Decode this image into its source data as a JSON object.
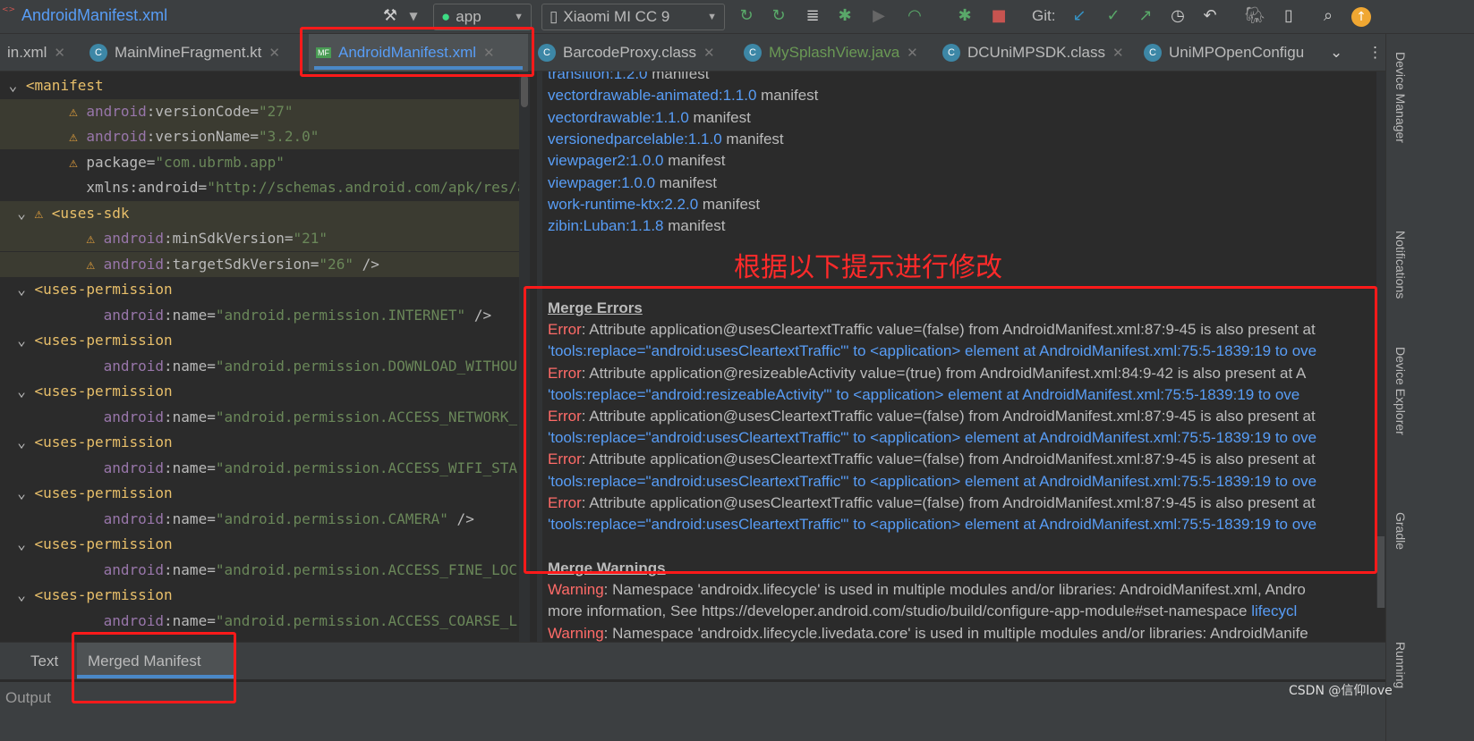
{
  "window": {
    "title": "AndroidManifest.xml",
    "file_icon": "xml-file-icon"
  },
  "toolbar": {
    "run_config": "app",
    "device": "Xiaomi MI CC 9",
    "git_label": "Git:",
    "icons": [
      "hammer-icon",
      "rerun-icon",
      "apply-changes-icon",
      "apply-code-changes-icon",
      "debug-icon",
      "attach-debugger-icon",
      "profile-icon",
      "debug-attach-icon",
      "stop-icon",
      "git-update-icon",
      "git-commit-icon",
      "git-push-icon",
      "history-icon",
      "rollback-icon",
      "gradle-sync-icon",
      "device-manager-icon",
      "search-icon",
      "update-icon"
    ]
  },
  "tabs": [
    {
      "label": "in.xml",
      "active": false
    },
    {
      "label": "MainMineFragment.kt",
      "active": false
    },
    {
      "label": "AndroidManifest.xml",
      "active": true
    },
    {
      "label": "BarcodeProxy.class",
      "active": false
    },
    {
      "label": "MySplashView.java",
      "active": false
    },
    {
      "label": "DCUniMPSDK.class",
      "active": false
    },
    {
      "label": "UniMPOpenConfigu",
      "active": false
    }
  ],
  "editor": {
    "lines": [
      {
        "indent": "",
        "tag": "<manifest",
        "fold": true
      },
      {
        "indent": "    ",
        "ns": "android",
        "attr": ":versionCode=",
        "val": "\"27\"",
        "warn": true,
        "hl": true
      },
      {
        "indent": "    ",
        "ns": "android",
        "attr": ":versionName=",
        "val": "\"3.2.0\"",
        "warn": true,
        "hl": true
      },
      {
        "indent": "    ",
        "ns": "",
        "attr": "package=",
        "val": "\"com.ubrmb.app\"",
        "warn": true
      },
      {
        "indent": "    ",
        "ns": "",
        "attr": "xmlns:android=",
        "val": "\"http://schemas.android.com/apk/res/a"
      },
      {
        "indent": "  ",
        "tag": "<uses-sdk",
        "fold": true,
        "warn": true,
        "hl": true
      },
      {
        "indent": "      ",
        "ns": "android",
        "attr": ":minSdkVersion=",
        "val": "\"21\"",
        "warn": true,
        "hl": true
      },
      {
        "indent": "      ",
        "ns": "android",
        "attr": ":targetSdkVersion=",
        "val": "\"26\"",
        "end": " />",
        "warn": true,
        "hl": true
      },
      {
        "indent": "  ",
        "tag": "<uses-permission",
        "fold": true
      },
      {
        "indent": "      ",
        "ns": "android",
        "attr": ":name=",
        "val": "\"android.permission.INTERNET\"",
        "end": " />"
      },
      {
        "indent": "  ",
        "tag": "<uses-permission",
        "fold": true
      },
      {
        "indent": "      ",
        "ns": "android",
        "attr": ":name=",
        "val": "\"android.permission.DOWNLOAD_WITHOU"
      },
      {
        "indent": "  ",
        "tag": "<uses-permission",
        "fold": true
      },
      {
        "indent": "      ",
        "ns": "android",
        "attr": ":name=",
        "val": "\"android.permission.ACCESS_NETWORK_"
      },
      {
        "indent": "  ",
        "tag": "<uses-permission",
        "fold": true
      },
      {
        "indent": "      ",
        "ns": "android",
        "attr": ":name=",
        "val": "\"android.permission.ACCESS_WIFI_STA"
      },
      {
        "indent": "  ",
        "tag": "<uses-permission",
        "fold": true
      },
      {
        "indent": "      ",
        "ns": "android",
        "attr": ":name=",
        "val": "\"android.permission.CAMERA\"",
        "end": " />"
      },
      {
        "indent": "  ",
        "tag": "<uses-permission",
        "fold": true
      },
      {
        "indent": "      ",
        "ns": "android",
        "attr": ":name=",
        "val": "\"android.permission.ACCESS_FINE_LOC"
      },
      {
        "indent": "  ",
        "tag": "<uses-permission",
        "fold": true
      },
      {
        "indent": "      ",
        "ns": "android",
        "attr": ":name=",
        "val": "\"android.permission.ACCESS_COARSE_L"
      }
    ]
  },
  "merged": {
    "libraries": [
      {
        "name": "transition:1.2.0",
        "suffix": " manifest"
      },
      {
        "name": "vectordrawable-animated:1.1.0",
        "suffix": " manifest"
      },
      {
        "name": "vectordrawable:1.1.0",
        "suffix": " manifest"
      },
      {
        "name": "versionedparcelable:1.1.0",
        "suffix": " manifest"
      },
      {
        "name": "viewpager2:1.0.0",
        "suffix": " manifest"
      },
      {
        "name": "viewpager:1.0.0",
        "suffix": " manifest"
      },
      {
        "name": "work-runtime-ktx:2.2.0",
        "suffix": " manifest"
      },
      {
        "name": "zibin:Luban:1.1.8",
        "suffix": " manifest"
      }
    ],
    "errors_title": "Merge Errors",
    "errors": [
      {
        "label": "Error",
        "text": ": Attribute application@usesCleartextTraffic value=(false) from AndroidManifest.xml:87:9-45 is also present at",
        "hint": "'tools:replace=\"android:usesCleartextTraffic\"' to <application> element at AndroidManifest.xml:75:5-1839:19 to ove"
      },
      {
        "label": "Error",
        "text": ": Attribute application@resizeableActivity value=(true) from AndroidManifest.xml:84:9-42 is also present at A",
        "hint": "'tools:replace=\"android:resizeableActivity\"' to <application> element at AndroidManifest.xml:75:5-1839:19 to ove"
      },
      {
        "label": "Error",
        "text": ": Attribute application@usesCleartextTraffic value=(false) from AndroidManifest.xml:87:9-45 is also present at",
        "hint": "'tools:replace=\"android:usesCleartextTraffic\"' to <application> element at AndroidManifest.xml:75:5-1839:19 to ove"
      },
      {
        "label": "Error",
        "text": ": Attribute application@usesCleartextTraffic value=(false) from AndroidManifest.xml:87:9-45 is also present at",
        "hint": "'tools:replace=\"android:usesCleartextTraffic\"' to <application> element at AndroidManifest.xml:75:5-1839:19 to ove"
      },
      {
        "label": "Error",
        "text": ": Attribute application@usesCleartextTraffic value=(false) from AndroidManifest.xml:87:9-45 is also present at",
        "hint": "'tools:replace=\"android:usesCleartextTraffic\"' to <application> element at AndroidManifest.xml:75:5-1839:19 to ove"
      }
    ],
    "warnings_title": "Merge Warnings",
    "warnings": [
      {
        "label": "Warning",
        "text": ": Namespace 'androidx.lifecycle' is used in multiple modules and/or libraries: AndroidManifest.xml, Andro",
        "more": "more information, See https://developer.android.com/studio/build/configure-app-module#set-namespace ",
        "link": "lifecycl"
      },
      {
        "label": "Warning",
        "text": ": Namespace 'androidx.lifecycle.livedata.core' is used in multiple modules and/or libraries: AndroidManife"
      }
    ]
  },
  "annotation": "根据以下提示进行修改",
  "side_tools": [
    "Device Manager",
    "Notifications",
    "Device Explorer",
    "Gradle",
    "Running"
  ],
  "bottom_tabs": [
    {
      "label": "Text",
      "active": false
    },
    {
      "label": "Merged Manifest",
      "active": true
    }
  ],
  "status": {
    "output": "Output"
  },
  "watermark": "CSDN @信仰love",
  "colors": {
    "accent": "#589df6",
    "error": "#ff6b68",
    "annotation": "#ff1a1a",
    "tag": "#e8bf6a",
    "value": "#6a8759"
  }
}
